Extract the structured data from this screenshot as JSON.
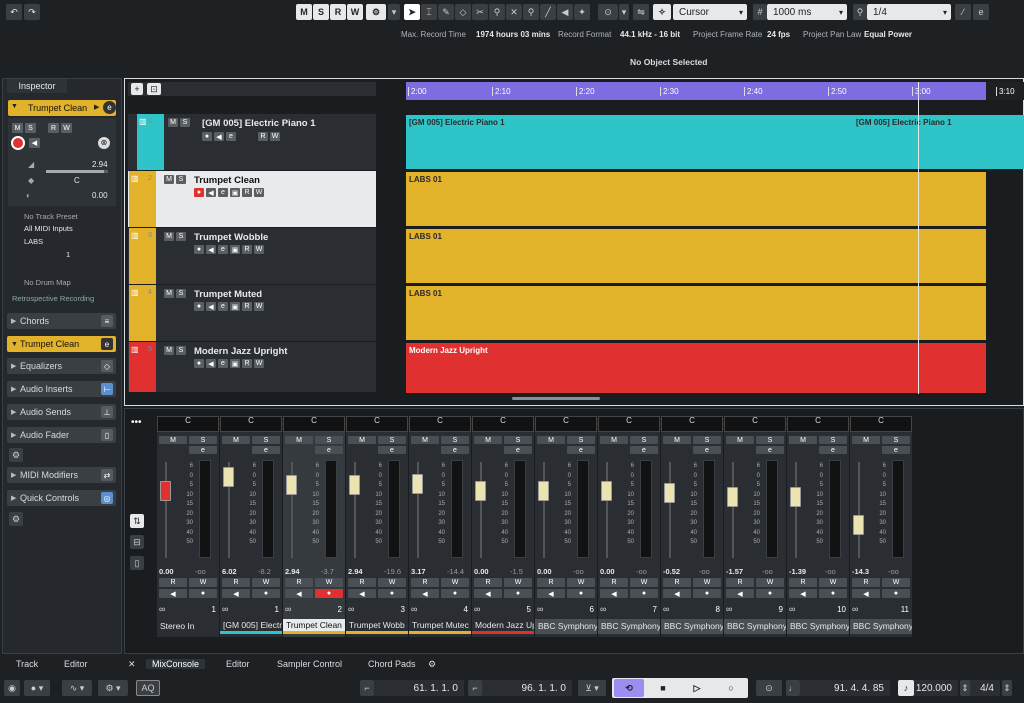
{
  "toolbar": {
    "msrw": [
      "M",
      "S",
      "R",
      "W"
    ],
    "mode_select": "Cursor",
    "nudge_value": "1000 ms",
    "quantize_value": "1/4"
  },
  "status": {
    "max_record_time_label": "Max. Record Time",
    "max_record_time": "1974 hours 03 mins",
    "record_format_label": "Record Format",
    "record_format": "44.1 kHz - 16 bit",
    "frame_rate_label": "Project Frame Rate",
    "frame_rate": "24 fps",
    "pan_law_label": "Project Pan Law",
    "pan_law": "Equal Power"
  },
  "info_line": "No Object Selected",
  "inspector": {
    "tab": "Inspector",
    "track_name": "Trumpet Clean",
    "volume": "2.94",
    "pan": "C",
    "delay": "0.00",
    "no_track_preset": "No Track Preset",
    "input": "All MIDI Inputs",
    "output": "LABS",
    "channel": "1",
    "no_drum_map": "No Drum Map",
    "retro_record": "Retrospective Recording",
    "sections": [
      "Chords",
      "Trumpet Clean",
      "Equalizers",
      "Audio Inserts",
      "Audio Sends",
      "Audio Fader",
      "MIDI Modifiers",
      "Quick Controls"
    ]
  },
  "ruler": [
    "2:00",
    "2:10",
    "2:20",
    "2:30",
    "2:40",
    "2:50",
    "3:00",
    "3:10"
  ],
  "tracks": [
    {
      "num": "1",
      "name": "[GM 005] Electric Piano 1",
      "color": "#2ec4c8",
      "events": [
        "[GM 005] Electric Piano 1",
        "[GM 005] Electric Piano 1"
      ]
    },
    {
      "num": "2",
      "name": "Trumpet Clean",
      "color": "#e2b22a",
      "events": [
        "LABS 01"
      ]
    },
    {
      "num": "3",
      "name": "Trumpet Wobble",
      "color": "#e2b22a",
      "events": [
        "LABS 01"
      ]
    },
    {
      "num": "4",
      "name": "Trumpet Muted",
      "color": "#e2b22a",
      "events": [
        "LABS 01"
      ]
    },
    {
      "num": "5",
      "name": "Modern Jazz Upright",
      "color": "#e03030",
      "events": [
        "Modern Jazz Upright"
      ]
    }
  ],
  "mixer": {
    "channels": [
      {
        "name": "Stereo In",
        "num": "1",
        "pan": "C",
        "vol": "0.00",
        "peak": "-oo",
        "color": "#2a2e32",
        "fader": 0.8
      },
      {
        "name": "[GM 005] Electr",
        "num": "1",
        "pan": "C",
        "vol": "6.02",
        "peak": "-8.2",
        "color": "#2ec4c8",
        "fader": 0.95
      },
      {
        "name": "Trumpet Clean",
        "num": "2",
        "pan": "C",
        "vol": "2.94",
        "peak": "-3.7",
        "color": "#e2b22a",
        "fader": 0.86
      },
      {
        "name": "Trumpet Wobb",
        "num": "3",
        "pan": "C",
        "vol": "2.94",
        "peak": "-19.6",
        "color": "#e2b22a",
        "fader": 0.86
      },
      {
        "name": "Trumpet Mutec",
        "num": "4",
        "pan": "C",
        "vol": "3.17",
        "peak": "-14.4",
        "color": "#e2b22a",
        "fader": 0.87
      },
      {
        "name": "Modern Jazz Up",
        "num": "5",
        "pan": "C",
        "vol": "0.00",
        "peak": "-1.5",
        "color": "#e03030",
        "fader": 0.8
      },
      {
        "name": "BBC Symphony",
        "num": "6",
        "pan": "C",
        "vol": "0.00",
        "peak": "-oo",
        "color": "#4a4f55",
        "fader": 0.8
      },
      {
        "name": "BBC Symphony",
        "num": "7",
        "pan": "C",
        "vol": "0.00",
        "peak": "-oo",
        "color": "#4a4f55",
        "fader": 0.8
      },
      {
        "name": "BBC Symphony",
        "num": "8",
        "pan": "C",
        "vol": "-0.52",
        "peak": "-oo",
        "color": "#4a4f55",
        "fader": 0.78
      },
      {
        "name": "BBC Symphony",
        "num": "9",
        "pan": "C",
        "vol": "-1.57",
        "peak": "-oo",
        "color": "#4a4f55",
        "fader": 0.74
      },
      {
        "name": "BBC Symphony",
        "num": "10",
        "pan": "C",
        "vol": "-1.39",
        "peak": "-oo",
        "color": "#4a4f55",
        "fader": 0.74
      },
      {
        "name": "BBC Symphony",
        "num": "11",
        "pan": "C",
        "vol": "-14.3",
        "peak": "-oo",
        "color": "#4a4f55",
        "fader": 0.45
      }
    ],
    "scale": [
      "6",
      "0",
      "5",
      "10",
      "15",
      "20",
      "30",
      "40",
      "50"
    ]
  },
  "lower_tabs": {
    "left": [
      "Track",
      "Editor"
    ],
    "right": [
      "MixConsole",
      "Editor",
      "Sampler Control",
      "Chord Pads"
    ]
  },
  "transport": {
    "left_locator": "61. 1. 1.   0",
    "right_locator": "96. 1. 1.   0",
    "position": "91. 4. 4.  85",
    "tempo": "120.000",
    "signature": "4/4",
    "aq": "AQ"
  }
}
